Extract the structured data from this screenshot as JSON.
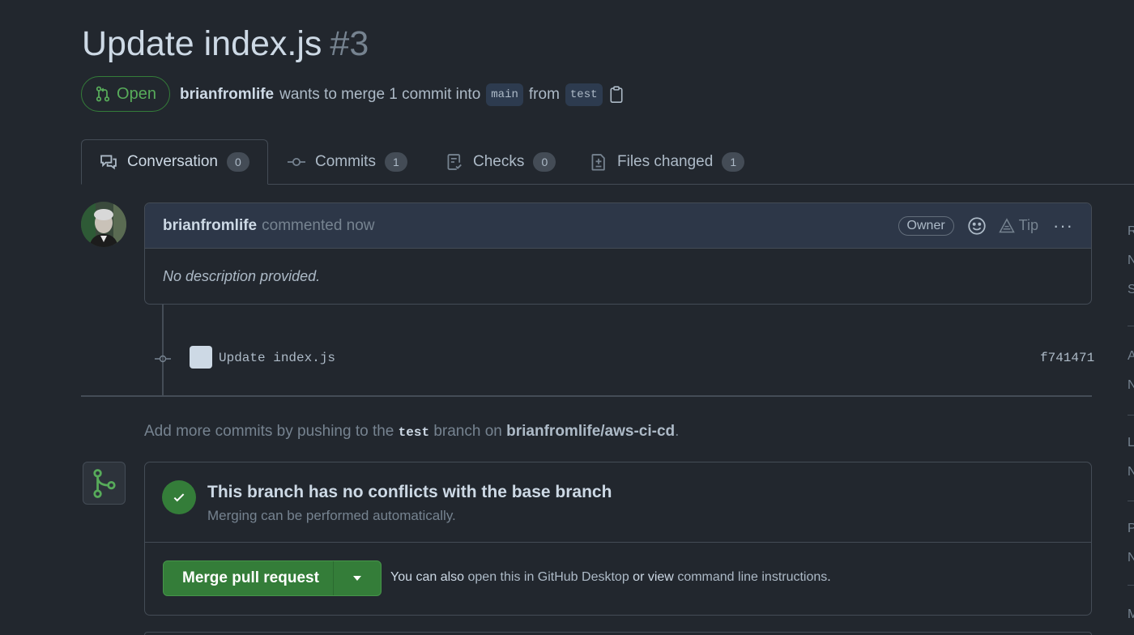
{
  "pr": {
    "title": "Update index.js",
    "number": "#3",
    "state": "Open"
  },
  "meta": {
    "author": "brianfromlife",
    "text": "wants to merge 1 commit into",
    "base": "main",
    "from": "from",
    "head": "test"
  },
  "tabs": [
    {
      "label": "Conversation",
      "count": "0"
    },
    {
      "label": "Commits",
      "count": "1"
    },
    {
      "label": "Checks",
      "count": "0"
    },
    {
      "label": "Files changed",
      "count": "1"
    }
  ],
  "comment": {
    "author": "brianfromlife",
    "action": "commented now",
    "badge": "Owner",
    "tip": "Tip",
    "body": "No description provided."
  },
  "commit": {
    "message": "Update index.js",
    "sha": "f741471"
  },
  "add_more": {
    "prefix": "Add more commits by pushing to the",
    "branch": "test",
    "middle": "branch on",
    "repo": "brianfromlife/aws-ci-cd",
    "suffix": "."
  },
  "merge": {
    "heading": "This branch has no conflicts with the base branch",
    "sub": "Merging can be performed automatically.",
    "button": "Merge pull request",
    "alt_prefix": "You can also",
    "alt_link1": "open this in GitHub Desktop",
    "alt_middle": "or view",
    "alt_link2": "command line instructions",
    "alt_suffix": "."
  },
  "sidebar_letters": [
    "R",
    "N",
    "S",
    "A",
    "N",
    "L",
    "N",
    "P",
    "N",
    "M"
  ],
  "colors": {
    "bg": "#22272e",
    "accent_green": "#347d39",
    "text": "#adbac7"
  }
}
